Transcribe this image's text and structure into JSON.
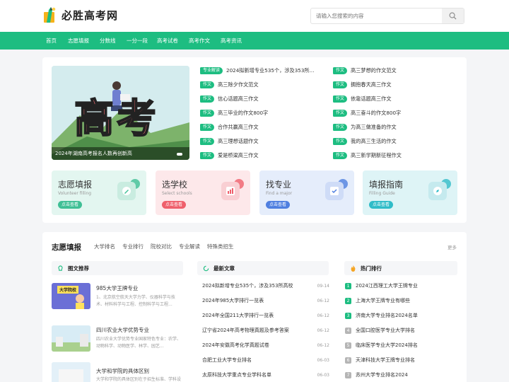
{
  "site": {
    "name": "必胜高考网"
  },
  "search": {
    "placeholder": "请输入您搜索的内容"
  },
  "nav": [
    "首页",
    "志愿填报",
    "分数线",
    "一分一段",
    "高考试卷",
    "高考作文",
    "高考资讯"
  ],
  "banner": {
    "big_text": "高考",
    "caption": "2024年湖南高考报名人数再创新高"
  },
  "news_left": [
    {
      "tag": "专业解读",
      "text": "2024拟新增专业535个，涉及353所..."
    },
    {
      "tag": "作文",
      "text": "高三除夕作文范文"
    },
    {
      "tag": "作文",
      "text": "信心话题高三作文"
    },
    {
      "tag": "作文",
      "text": "高三毕业的作文800字"
    },
    {
      "tag": "作文",
      "text": "合作共赢高三作文"
    },
    {
      "tag": "作文",
      "text": "高三理想话题作文"
    },
    {
      "tag": "作文",
      "text": "爱是桥梁高三作文"
    }
  ],
  "news_right": [
    {
      "tag": "作文",
      "text": "高三梦想的作文范文"
    },
    {
      "tag": "作文",
      "text": "拥抱春天高三作文"
    },
    {
      "tag": "作文",
      "text": "依靠话题高三作文"
    },
    {
      "tag": "作文",
      "text": "高三奋斗的作文800字"
    },
    {
      "tag": "作文",
      "text": "为高三做准备的作文"
    },
    {
      "tag": "作文",
      "text": "我的高三生活的作文"
    },
    {
      "tag": "作文",
      "text": "高三新学期新征程作文"
    }
  ],
  "quick": [
    {
      "title": "志愿填报",
      "sub": "Volunteer filling",
      "btn": "点击查看",
      "bg": "#e3f6f0",
      "accent": "#3fbf95"
    },
    {
      "title": "选学校",
      "sub": "Select schools",
      "btn": "点击查看",
      "bg": "#fde8ea",
      "accent": "#ef5f6b"
    },
    {
      "title": "找专业",
      "sub": "Find a major",
      "btn": "点击查看",
      "bg": "#e5edfb",
      "accent": "#4f7fe0"
    },
    {
      "title": "填报指南",
      "sub": "Filling Guide",
      "btn": "点击查看",
      "bg": "#def4f6",
      "accent": "#2fbcc8"
    }
  ],
  "section": {
    "title": "志愿填报",
    "tabs": [
      "大学排名",
      "专业排行",
      "院校对比",
      "专业解读",
      "特殊类招生"
    ],
    "more": "更多"
  },
  "columns": {
    "pics": "图文推荐",
    "articles": "最新文章",
    "ranks": "热门排行"
  },
  "pics": [
    {
      "thumb_text": "大学院校",
      "title": "985大学王牌专业",
      "desc": "1、北京航空航天大学力学、仪器科学与技术、材料科学与工程、控制科学与工程..."
    },
    {
      "thumb_text": "",
      "title": "四川农业大学优势专业",
      "desc": "四川农业大学优势专业国家特色专业：农学、动物科学、动物医学、林学、园艺..."
    },
    {
      "thumb_text": "",
      "title": "大学和学院的具体区别",
      "desc": "大学和学院的具体区别在于招生标准、学科设置..."
    }
  ],
  "articles": [
    {
      "title": "2024拟新增专业535个，涉及353所高校",
      "date": "09-14"
    },
    {
      "title": "2024年985大学排行一览表",
      "date": "06-12"
    },
    {
      "title": "2024年全国211大学排行一览表",
      "date": "06-12"
    },
    {
      "title": "辽宁省2024年高考物理真题及参考答案",
      "date": "06-12"
    },
    {
      "title": "2024年安徽高考化学真题试卷",
      "date": "06-12"
    },
    {
      "title": "合肥工业大学专业排名",
      "date": "06-03"
    },
    {
      "title": "太原科技大学重点专业学科名单",
      "date": "06-03"
    }
  ],
  "ranks": [
    {
      "n": "1",
      "title": "2024江西理工大学王牌专业",
      "color": "#1dbd81"
    },
    {
      "n": "2",
      "title": "上海大学王牌专业有哪些",
      "color": "#1dbd81"
    },
    {
      "n": "3",
      "title": "济南大学专业排名2024名单",
      "color": "#1dbd81"
    },
    {
      "n": "4",
      "title": "全国口腔医学专业大学排名",
      "color": "#b5b5b5"
    },
    {
      "n": "5",
      "title": "临床医学专业大学2024排名",
      "color": "#b5b5b5"
    },
    {
      "n": "6",
      "title": "天津科技大学王牌专业排名",
      "color": "#b5b5b5"
    },
    {
      "n": "7",
      "title": "苏州大学专业排名2024",
      "color": "#b5b5b5"
    }
  ]
}
